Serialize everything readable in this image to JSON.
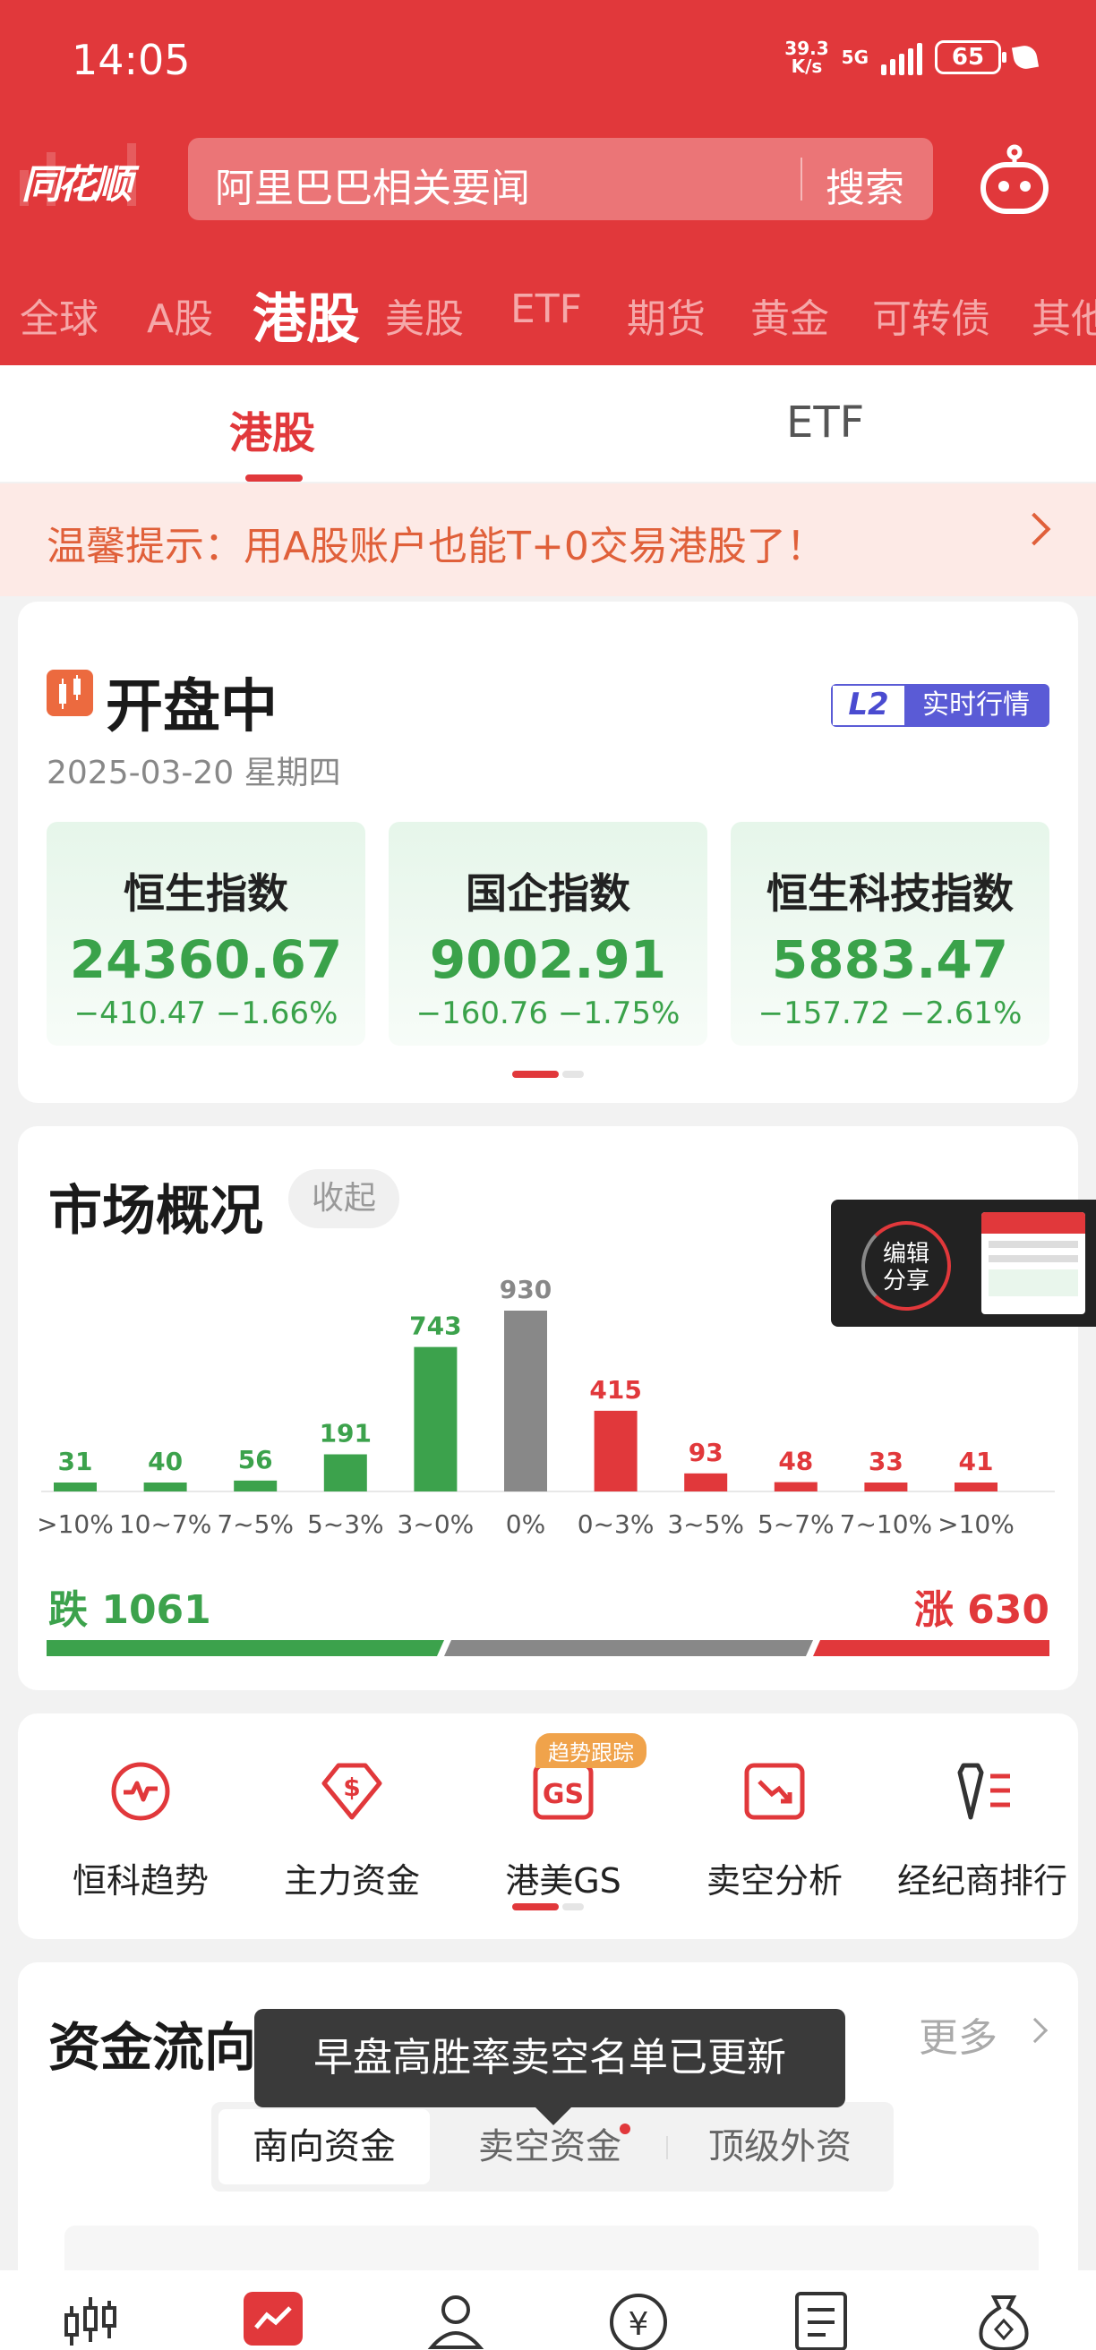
{
  "status_bar": {
    "time": "14:05",
    "net_speed_value": "39.3",
    "net_speed_unit": "K/s",
    "network": "5G",
    "battery": "65"
  },
  "header": {
    "logo": "同花顺",
    "search_placeholder": "阿里巴巴相关要闻",
    "search_button": "搜索",
    "market_tabs": [
      "全球",
      "A股",
      "港股",
      "美股",
      "ETF",
      "期货",
      "黄金",
      "可转债",
      "其他"
    ],
    "active_market_tab": "港股"
  },
  "sub_tabs": {
    "items": [
      "港股",
      "ETF"
    ],
    "active": "港股"
  },
  "notice": {
    "text": "温馨提示：用A股账户也能T+0交易港股了！"
  },
  "market_status": {
    "title": "开盘中",
    "date": "2025-03-20 星期四",
    "badge_mark": "L2",
    "badge_text": "实时行情",
    "indices": [
      {
        "name": "恒生指数",
        "value": "24360.67",
        "change": "−410.47  −1.66%"
      },
      {
        "name": "国企指数",
        "value": "9002.91",
        "change": "−160.76  −1.75%"
      },
      {
        "name": "恒生科技指数",
        "value": "5883.47",
        "change": "−157.72  −2.61%"
      }
    ]
  },
  "overview": {
    "title": "市场概况",
    "collapse_label": "收起",
    "share_label_1": "编辑",
    "share_label_2": "分享",
    "fall_label": "跌",
    "fall_count": "1061",
    "rise_label": "涨",
    "rise_count": "630",
    "colors": {
      "down": "#3ca24c",
      "flat": "#888888",
      "up": "#e1383b"
    }
  },
  "chart_data": {
    "type": "bar",
    "categories": [
      ">10%",
      "10~7%",
      "7~5%",
      "5~3%",
      "3~0%",
      "0%",
      "0~3%",
      "3~5%",
      "5~7%",
      "7~10%",
      ">10%"
    ],
    "values": [
      31,
      40,
      56,
      191,
      743,
      930,
      415,
      93,
      48,
      33,
      41
    ],
    "bar_groups": [
      "down",
      "down",
      "down",
      "down",
      "down",
      "flat",
      "up",
      "up",
      "up",
      "up",
      "up"
    ],
    "ylim": [
      0,
      930
    ]
  },
  "tools": {
    "items": [
      {
        "label": "恒科趋势",
        "icon": "pulse-icon"
      },
      {
        "label": "主力资金",
        "icon": "money-tag-icon"
      },
      {
        "label": "港美GS",
        "icon": "gs-icon"
      },
      {
        "label": "卖空分析",
        "icon": "down-trend-icon"
      },
      {
        "label": "经纪商排行",
        "icon": "broker-rank-icon"
      }
    ],
    "badge": "趋势跟踪"
  },
  "capital_flow": {
    "title": "资金流向",
    "more_label": "更多",
    "tooltip": "早盘高胜率卖空名单已更新",
    "segments": [
      "南向资金",
      "卖空资金",
      "顶级外资"
    ],
    "active_segment": "南向资金"
  },
  "bottom_nav": [
    "market-icon",
    "quote-icon",
    "user-icon",
    "yuan-icon",
    "news-icon",
    "money-bag-icon"
  ]
}
